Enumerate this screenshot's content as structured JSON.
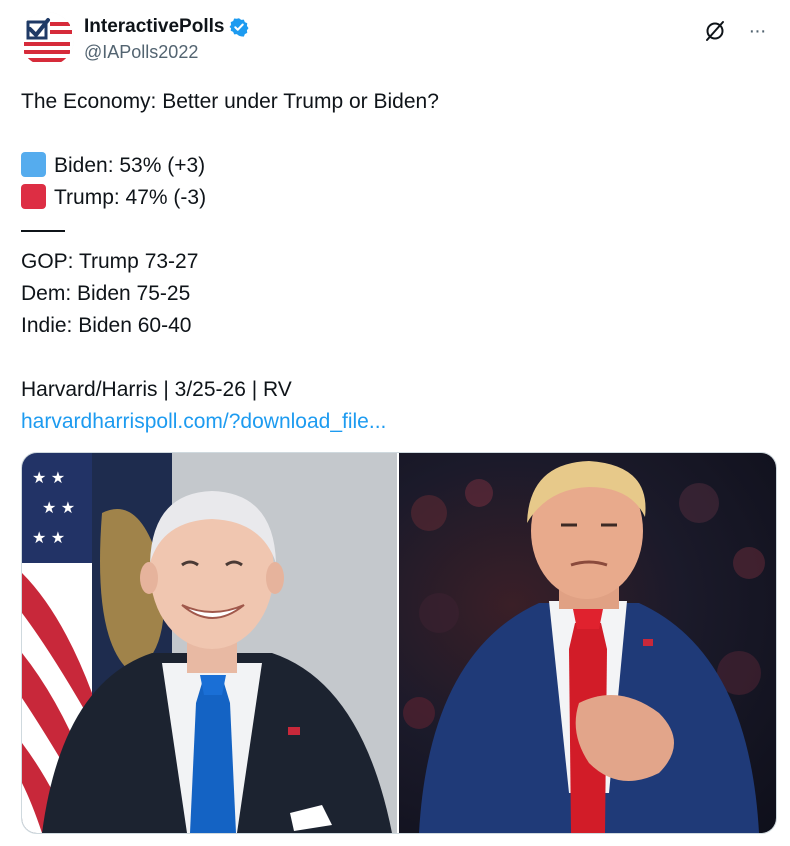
{
  "author": {
    "display_name": "InteractivePolls",
    "handle": "@IAPolls2022",
    "verified": true,
    "avatar_icon": "flag-checkbox-avatar"
  },
  "top_actions": {
    "grok_icon": "slashed-circle-icon",
    "more_icon": "more-icon",
    "more_label": "···"
  },
  "tweet": {
    "question": "The Economy: Better under Trump or Biden?",
    "results": [
      {
        "color": "blue",
        "text": "Biden: 53% (+3)"
      },
      {
        "color": "red",
        "text": "Trump: 47% (-3)"
      }
    ],
    "breakdown": [
      "GOP: Trump 73-27",
      "Dem: Biden 75-25",
      "Indie: Biden 60-40"
    ],
    "source": "Harvard/Harris | 3/25-26 | RV",
    "link": "harvardharrispoll.com/?download_file..."
  },
  "colors": {
    "biden_square": "#55acee",
    "trump_square": "#dd2e44",
    "link": "#1d9bf0",
    "verified": "#1d9bf0",
    "handle": "#536471"
  },
  "media": {
    "left_photo": "biden-portrait",
    "right_photo": "trump-portrait"
  }
}
